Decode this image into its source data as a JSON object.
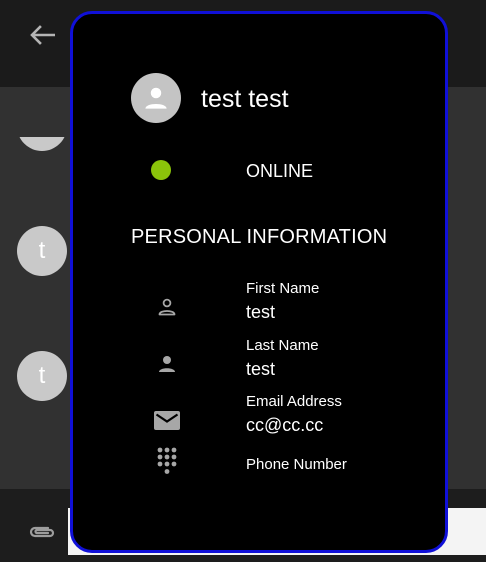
{
  "background": {
    "chat_avatars": [
      {
        "letter": "t"
      },
      {
        "letter": "t"
      }
    ]
  },
  "profile": {
    "name": "test test",
    "status": "ONLINE",
    "status_color": "#8bc40a",
    "section_title": "PERSONAL INFORMATION",
    "fields": [
      {
        "icon": "person-outline-icon",
        "label": "First Name",
        "value": "test"
      },
      {
        "icon": "person-icon",
        "label": "Last Name",
        "value": "test"
      },
      {
        "icon": "email-icon",
        "label": "Email Address",
        "value": "cc@cc.cc"
      },
      {
        "icon": "dialpad-icon",
        "label": "Phone Number",
        "value": ""
      }
    ]
  },
  "colors": {
    "modal_border": "#1010d8",
    "modal_bg": "#000000",
    "icon_gray": "#a7a7a7"
  }
}
